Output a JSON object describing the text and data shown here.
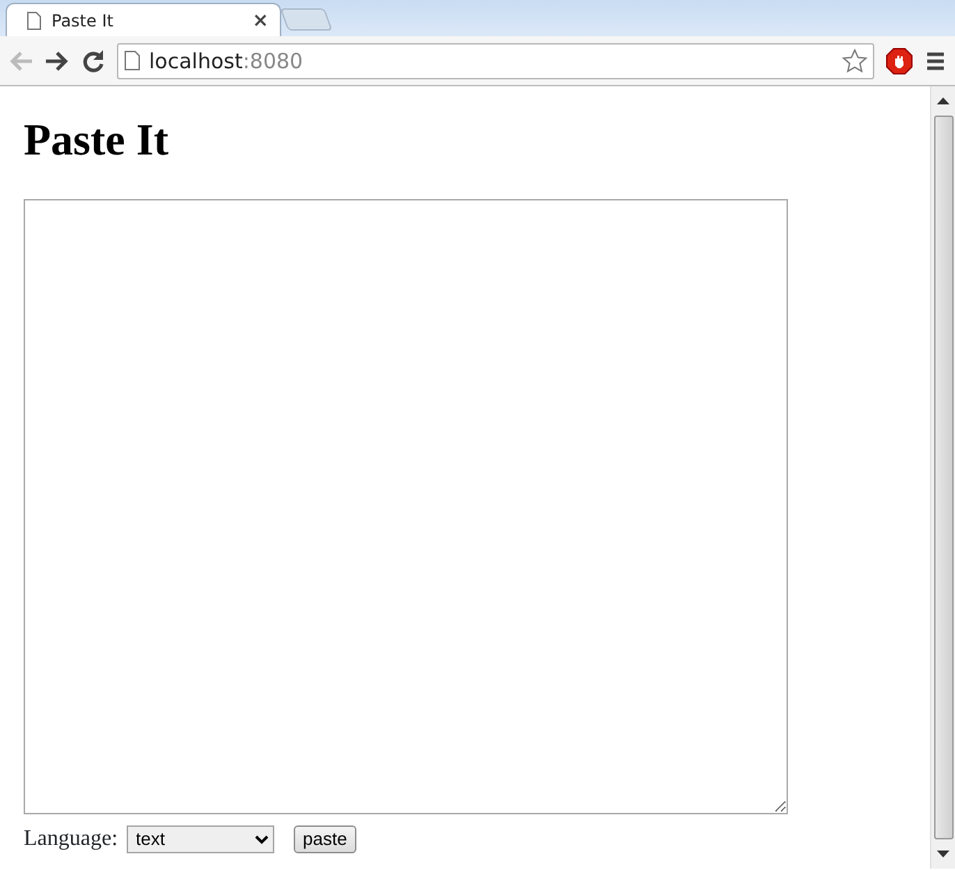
{
  "tabs": [
    {
      "title": "Paste It",
      "close": "×",
      "selected": true
    }
  ],
  "address_bar": {
    "host": "localhost",
    "port": ":8080"
  },
  "page": {
    "heading": "Paste It",
    "language_label": "Language:",
    "language_select": {
      "value": "text"
    },
    "button": "paste"
  }
}
